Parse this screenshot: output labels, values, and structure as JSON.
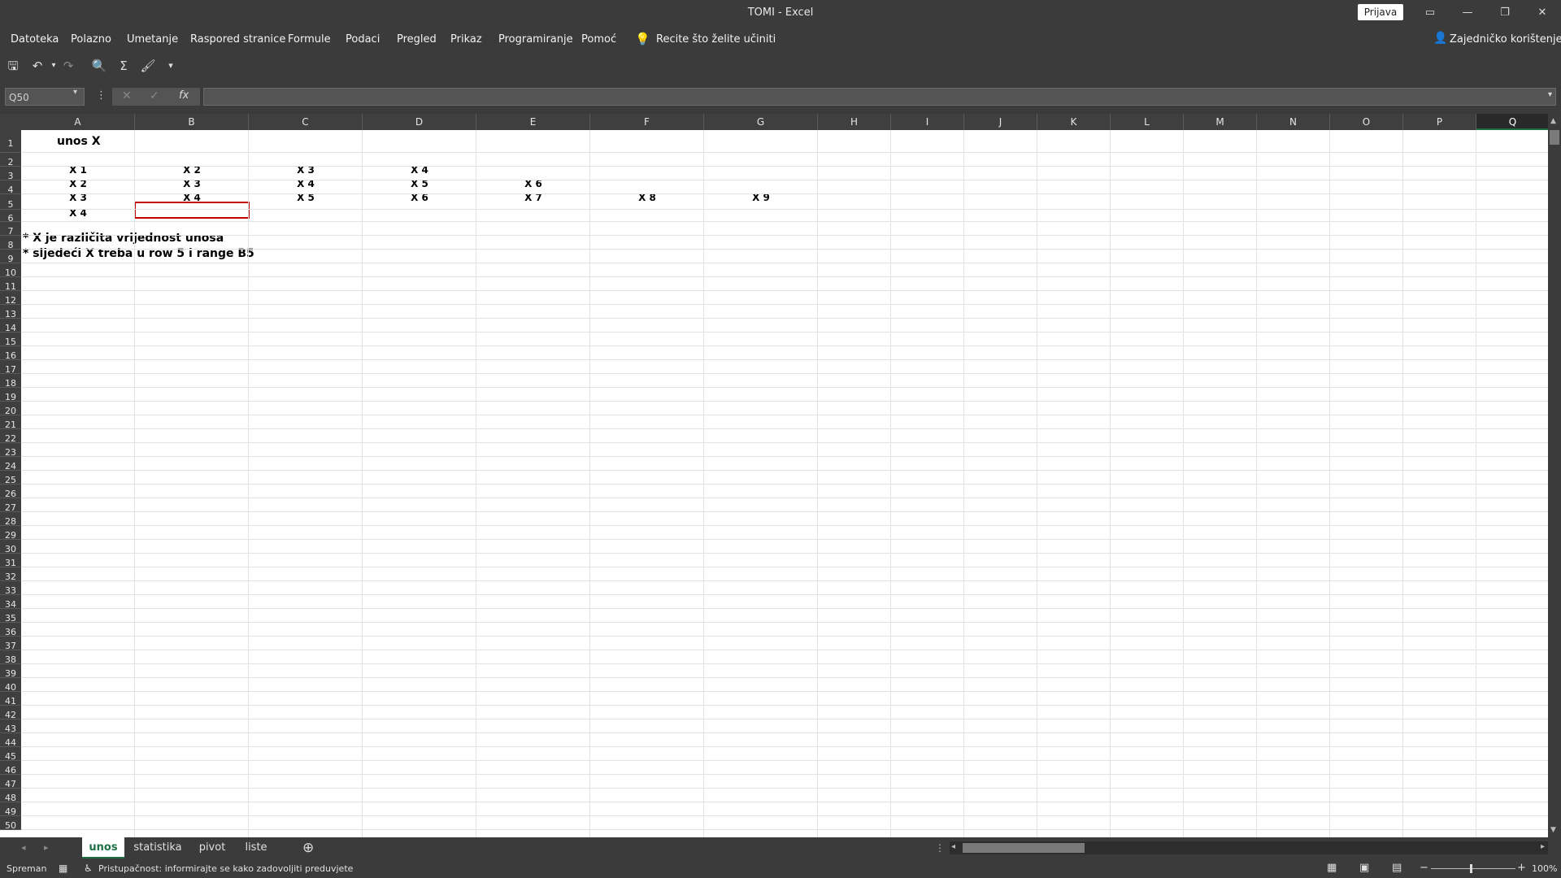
{
  "window": {
    "title": "TOMI  -  Excel",
    "sign_in": "Prijava"
  },
  "ribbon_tabs": [
    "Datoteka",
    "Polazno",
    "Umetanje",
    "Raspored stranice",
    "Formule",
    "Podaci",
    "Pregled",
    "Prikaz",
    "Programiranje",
    "Pomoć"
  ],
  "tell_me": "Recite što želite učiniti",
  "share": "Zajedničko korištenje",
  "namebox": "Q50",
  "columns": [
    "A",
    "B",
    "C",
    "D",
    "E",
    "F",
    "G",
    "H",
    "I",
    "J",
    "K",
    "L",
    "M",
    "N",
    "O",
    "P",
    "Q"
  ],
  "rows": [
    "1",
    "2",
    "3",
    "4",
    "5",
    "6",
    "7",
    "8",
    "9",
    "10",
    "11",
    "12",
    "13",
    "14",
    "15",
    "16",
    "17",
    "18",
    "19",
    "20",
    "21",
    "22",
    "23",
    "24",
    "25",
    "26",
    "27",
    "28",
    "29",
    "30",
    "31",
    "32",
    "33",
    "34",
    "35",
    "36",
    "37",
    "38",
    "39",
    "40",
    "41",
    "42",
    "43",
    "44",
    "45",
    "46",
    "47",
    "48",
    "49",
    "50"
  ],
  "cells": {
    "A1": "unos X",
    "A2": "X 1",
    "B2": "X 2",
    "C2": "X 3",
    "D2": "X 4",
    "A3": "X 2",
    "B3": "X 3",
    "C3": "X 4",
    "D3": "X 5",
    "E3": "X 6",
    "A4": "X 3",
    "B4": "X 4",
    "C4": "X 5",
    "D4": "X 6",
    "E4": "X 7",
    "F4": "X 8",
    "G4": "X 9",
    "A5": "X 4",
    "A7": "* X je različita vrijednost unosa",
    "A8": "* sljedeći X  treba u row 5 i range B5"
  },
  "sheets": [
    "unos",
    "statistika",
    "pivot",
    "liste"
  ],
  "status": {
    "ready": "Spreman",
    "accessibility": "Pristupačnost: informirajte se kako zadovoljiti preduvjete",
    "zoom": "100%"
  }
}
